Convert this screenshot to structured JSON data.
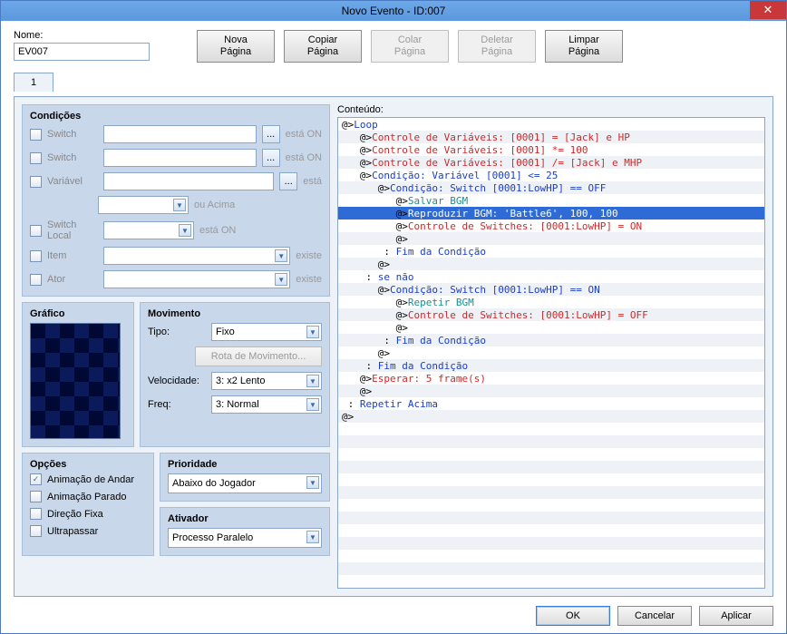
{
  "window": {
    "title": "Novo Evento - ID:007"
  },
  "name": {
    "label": "Nome:",
    "value": "EV007"
  },
  "toolbar": {
    "novaL1": "Nova",
    "novaL2": "Página",
    "copiarL1": "Copiar",
    "copiarL2": "Página",
    "colarL1": "Colar",
    "colarL2": "Página",
    "deletarL1": "Deletar",
    "deletarL2": "Página",
    "limparL1": "Limpar",
    "limparL2": "Página"
  },
  "tab1": "1",
  "conditions": {
    "legend": "Condições",
    "switch1": "Switch",
    "switch1_suffix": "está ON",
    "switch2": "Switch",
    "switch2_suffix": "está ON",
    "variable": "Variável",
    "variable_suffix": "está",
    "variable_value_suffix": "ou Acima",
    "switchLocal": "Switch Local",
    "switchLocal_suffix": "está ON",
    "item": "Item",
    "item_suffix": "existe",
    "actor": "Ator",
    "actor_suffix": "existe"
  },
  "graphic": {
    "legend": "Gráfico"
  },
  "movement": {
    "legend": "Movimento",
    "type_label": "Tipo:",
    "type_value": "Fixo",
    "route_btn": "Rota de Movimento...",
    "speed_label": "Velocidade:",
    "speed_value": "3: x2 Lento",
    "freq_label": "Freq:",
    "freq_value": "3: Normal"
  },
  "options": {
    "legend": "Opções",
    "walk": "Animação de Andar",
    "stopped": "Animação Parado",
    "fixed_dir": "Direção Fixa",
    "through": "Ultrapassar"
  },
  "priority": {
    "legend": "Prioridade",
    "value": "Abaixo do Jogador"
  },
  "trigger": {
    "legend": "Ativador",
    "value": "Processo Paralelo"
  },
  "content_label": "Conteúdo:",
  "content_lines": [
    {
      "indent": 0,
      "mark": "@>",
      "c": "blue",
      "text": "Loop"
    },
    {
      "indent": 1,
      "mark": "@>",
      "c": "red",
      "text": "Controle de Variáveis: [0001] = [Jack] e HP"
    },
    {
      "indent": 1,
      "mark": "@>",
      "c": "red",
      "text": "Controle de Variáveis: [0001] *= 100"
    },
    {
      "indent": 1,
      "mark": "@>",
      "c": "red",
      "text": "Controle de Variáveis: [0001] /= [Jack] e MHP"
    },
    {
      "indent": 1,
      "mark": "@>",
      "c": "blue",
      "text": "Condição: Variável [0001] <= 25"
    },
    {
      "indent": 2,
      "mark": "@>",
      "c": "blue",
      "text": "Condição: Switch [0001:LowHP] == OFF"
    },
    {
      "indent": 3,
      "mark": "@>",
      "c": "teal",
      "text": "Salvar BGM"
    },
    {
      "indent": 3,
      "mark": "@>",
      "c": "teal",
      "text": "Reproduzir BGM: 'Battle6', 100, 100",
      "selected": true
    },
    {
      "indent": 3,
      "mark": "@>",
      "c": "red",
      "text": "Controle de Switches: [0001:LowHP] = ON"
    },
    {
      "indent": 3,
      "mark": "@>",
      "c": "black",
      "text": ""
    },
    {
      "indent": 2,
      "mark": " :",
      "c": "blue",
      "text": " Fim da Condição"
    },
    {
      "indent": 2,
      "mark": "@>",
      "c": "black",
      "text": ""
    },
    {
      "indent": 1,
      "mark": " :",
      "c": "blue",
      "text": " se não"
    },
    {
      "indent": 2,
      "mark": "@>",
      "c": "blue",
      "text": "Condição: Switch [0001:LowHP] == ON"
    },
    {
      "indent": 3,
      "mark": "@>",
      "c": "teal",
      "text": "Repetir BGM"
    },
    {
      "indent": 3,
      "mark": "@>",
      "c": "red",
      "text": "Controle de Switches: [0001:LowHP] = OFF"
    },
    {
      "indent": 3,
      "mark": "@>",
      "c": "black",
      "text": ""
    },
    {
      "indent": 2,
      "mark": " :",
      "c": "blue",
      "text": " Fim da Condição"
    },
    {
      "indent": 2,
      "mark": "@>",
      "c": "black",
      "text": ""
    },
    {
      "indent": 1,
      "mark": " :",
      "c": "blue",
      "text": " Fim da Condição"
    },
    {
      "indent": 1,
      "mark": "@>",
      "c": "red",
      "text": "Esperar: 5 frame(s)"
    },
    {
      "indent": 1,
      "mark": "@>",
      "c": "black",
      "text": ""
    },
    {
      "indent": 0,
      "mark": " :",
      "c": "blue",
      "text": " Repetir Acima"
    },
    {
      "indent": 0,
      "mark": "@>",
      "c": "black",
      "text": ""
    }
  ],
  "buttons": {
    "ok": "OK",
    "cancel": "Cancelar",
    "apply": "Aplicar"
  }
}
